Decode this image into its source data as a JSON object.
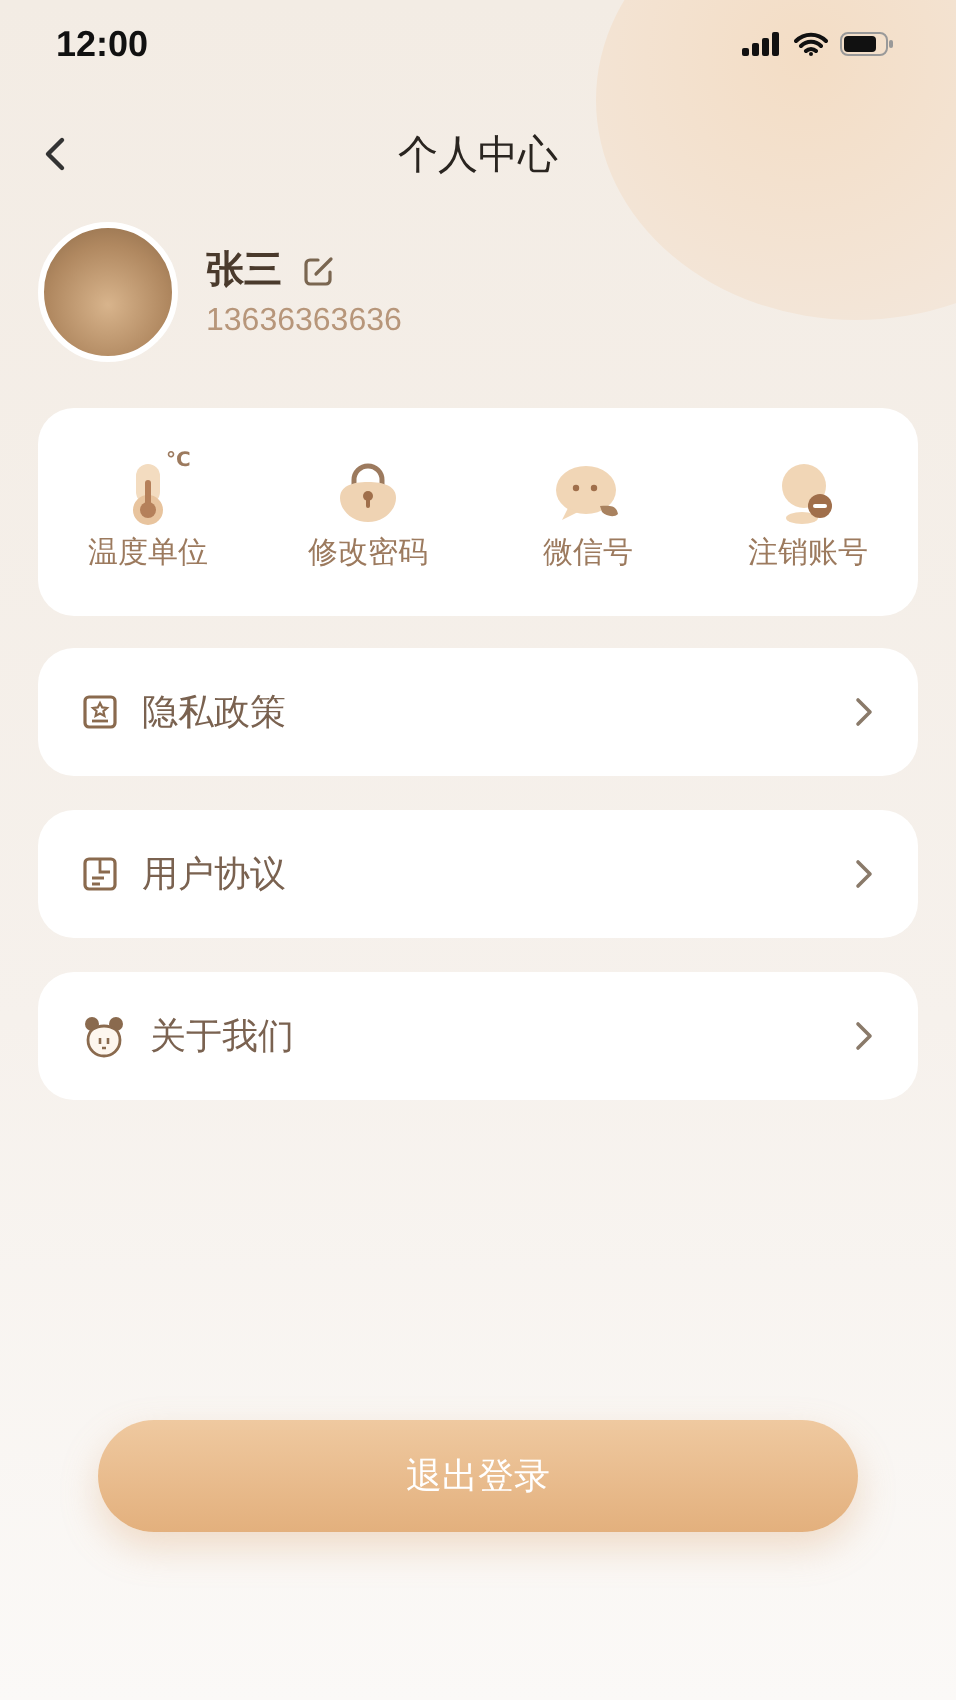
{
  "status_bar": {
    "time": "12:00"
  },
  "header": {
    "title": "个人中心"
  },
  "profile": {
    "name": "张三",
    "phone": "13636363636"
  },
  "quick_actions": [
    {
      "kind": "thermometer",
      "label": "温度单位",
      "unit": "°C"
    },
    {
      "kind": "lock",
      "label": "修改密码"
    },
    {
      "kind": "chat",
      "label": "微信号"
    },
    {
      "kind": "cancel",
      "label": "注销账号"
    }
  ],
  "menu": [
    {
      "kind": "policy",
      "label": "隐私政策"
    },
    {
      "kind": "agreement",
      "label": "用户协议"
    },
    {
      "kind": "about",
      "label": "关于我们"
    }
  ],
  "logout_button": "退出登录"
}
